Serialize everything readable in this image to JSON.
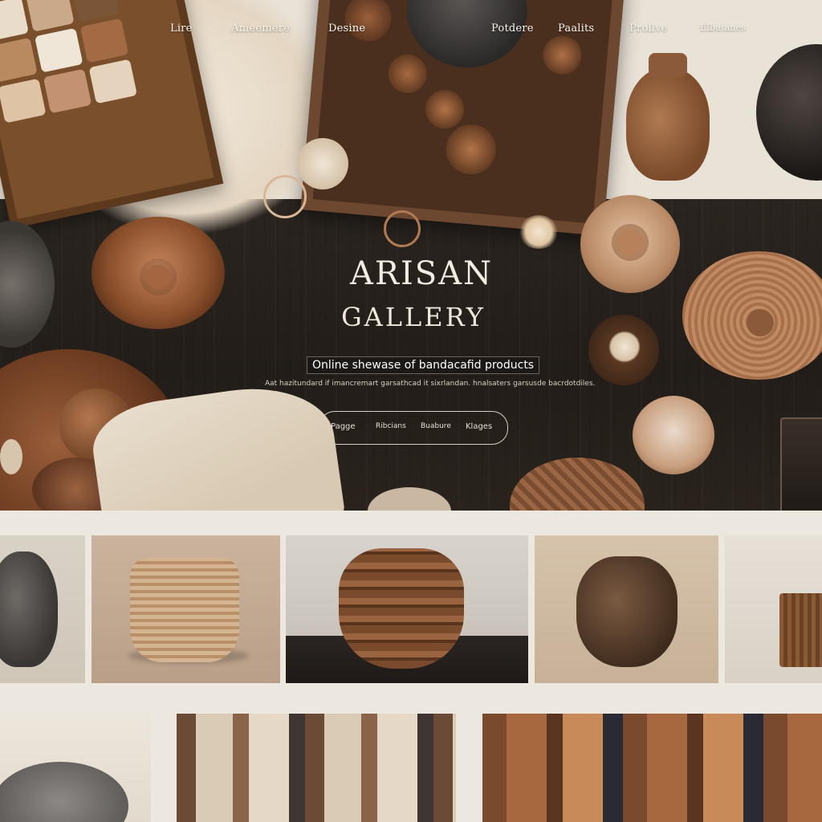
{
  "nav": {
    "items": [
      "Lire",
      "Anieemere",
      "Desine",
      "Potdere",
      "Paalits",
      "Prolive",
      "Elbatanes"
    ]
  },
  "hero": {
    "title_line1": "ARISAN",
    "title_line2": "GALLERY",
    "tagline": "Online shewase of bandacafid products",
    "description": "Aat hazitundard if imancremart garsathcad it sixrlandan. hnalsaters garsusde bacrdotdiles.",
    "buttons": [
      "Pagge",
      "Ribcians",
      "Buabure",
      "Klages"
    ]
  },
  "colors": {
    "wood_dark": "#241e1a",
    "cream": "#ece7df",
    "terracotta": "#a86a42",
    "clay": "#8b5a3a"
  },
  "gallery": {
    "row1": [
      "carved-vase",
      "twine-basket",
      "patterned-pot",
      "bronze-teapot",
      "wicker-box"
    ],
    "row2": [
      "grey-cat",
      "printed-fabrics",
      "embroidered-textiles"
    ]
  }
}
